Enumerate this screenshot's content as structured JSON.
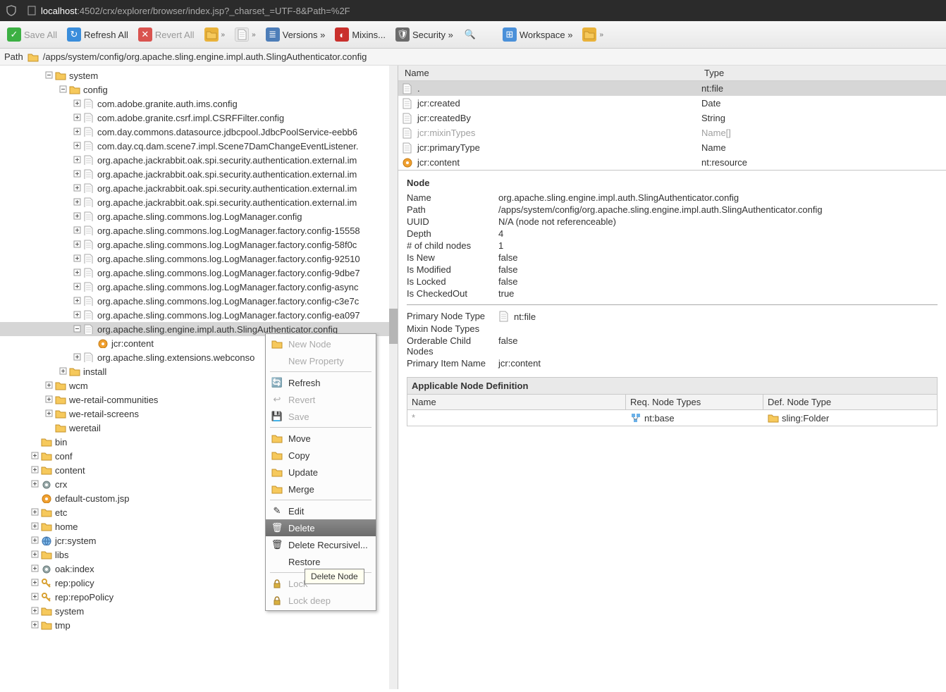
{
  "url_prefix": "localhost",
  "url_suffix": ":4502/crx/explorer/browser/index.jsp?_charset_=UTF-8&Path=%2F",
  "toolbar": {
    "save_all": "Save All",
    "refresh_all": "Refresh All",
    "revert_all": "Revert All",
    "versions": "Versions »",
    "mixins": "Mixins...",
    "security": "Security »",
    "workspace": "Workspace »"
  },
  "path_label": "Path",
  "path_value": "/apps/system/config/org.apache.sling.engine.impl.auth.SlingAuthenticator.config",
  "tree": {
    "system": "system",
    "config": "config",
    "children": [
      "com.adobe.granite.auth.ims.config",
      "com.adobe.granite.csrf.impl.CSRFFilter.config",
      "com.day.commons.datasource.jdbcpool.JdbcPoolService-eebb6",
      "com.day.cq.dam.scene7.impl.Scene7DamChangeEventListener.",
      "org.apache.jackrabbit.oak.spi.security.authentication.external.im",
      "org.apache.jackrabbit.oak.spi.security.authentication.external.im",
      "org.apache.jackrabbit.oak.spi.security.authentication.external.im",
      "org.apache.jackrabbit.oak.spi.security.authentication.external.im",
      "org.apache.sling.commons.log.LogManager.config",
      "org.apache.sling.commons.log.LogManager.factory.config-15558",
      "org.apache.sling.commons.log.LogManager.factory.config-58f0c",
      "org.apache.sling.commons.log.LogManager.factory.config-92510",
      "org.apache.sling.commons.log.LogManager.factory.config-9dbe7",
      "org.apache.sling.commons.log.LogManager.factory.config-async",
      "org.apache.sling.commons.log.LogManager.factory.config-c3e7c",
      "org.apache.sling.commons.log.LogManager.factory.config-ea097"
    ],
    "selected": "org.apache.sling.engine.impl.auth.SlingAuthenticator.config",
    "jcr_content": "jcr:content",
    "webcons": "org.apache.sling.extensions.webconso",
    "install": "install",
    "wcm": "wcm",
    "wrc": "we-retail-communities",
    "wrs": "we-retail-screens",
    "weretail": "weretail",
    "bin": "bin",
    "conf": "conf",
    "content": "content",
    "crx": "crx",
    "dcj": "default-custom.jsp",
    "etc": "etc",
    "home": "home",
    "jcrsys": "jcr:system",
    "libs": "libs",
    "oaki": "oak:index",
    "repp": "rep:policy",
    "reprp": "rep:repoPolicy",
    "sys2": "system",
    "tmp": "tmp"
  },
  "props": {
    "head_name": "Name",
    "head_type": "Type",
    "rows": [
      {
        "name": ".",
        "type": "nt:file",
        "ico": "file",
        "sel": true
      },
      {
        "name": "jcr:created",
        "type": "Date",
        "ico": "file"
      },
      {
        "name": "jcr:createdBy",
        "type": "String",
        "ico": "file"
      },
      {
        "name": "jcr:mixinTypes",
        "type": "Name[]",
        "ico": "file",
        "muted": true
      },
      {
        "name": "jcr:primaryType",
        "type": "Name",
        "ico": "file"
      },
      {
        "name": "jcr:content",
        "type": "nt:resource",
        "ico": "res"
      }
    ]
  },
  "node": {
    "title": "Node",
    "name_l": "Name",
    "name_v": "org.apache.sling.engine.impl.auth.SlingAuthenticator.config",
    "path_l": "Path",
    "path_v": "/apps/system/config/org.apache.sling.engine.impl.auth.SlingAuthenticator.config",
    "uuid_l": "UUID",
    "uuid_v": "N/A (node not referenceable)",
    "depth_l": "Depth",
    "depth_v": "4",
    "nchild_l": "# of child nodes",
    "nchild_v": "1",
    "isnew_l": "Is New",
    "isnew_v": "false",
    "ismod_l": "Is Modified",
    "ismod_v": "false",
    "islock_l": "Is Locked",
    "islock_v": "false",
    "isco_l": "Is CheckedOut",
    "isco_v": "true",
    "pnt_l": "Primary Node Type",
    "pnt_v": "nt:file",
    "mnt_l": "Mixin Node Types",
    "ocn_l": "Orderable Child Nodes",
    "ocn_v": "false",
    "pin_l": "Primary Item Name",
    "pin_v": "jcr:content"
  },
  "app": {
    "title": "Applicable Node Definition",
    "c1": "Name",
    "c2": "Req. Node Types",
    "c3": "Def. Node Type",
    "r1": "*",
    "r2": "nt:base",
    "r3": "sling:Folder"
  },
  "ctx": {
    "new_node": "New Node",
    "new_prop": "New Property",
    "refresh": "Refresh",
    "revert": "Revert",
    "save": "Save",
    "move": "Move",
    "copy": "Copy",
    "update": "Update",
    "merge": "Merge",
    "edit": "Edit",
    "delete": "Delete",
    "delete_rec": "Delete Recursivel...",
    "restore": "Restore",
    "lock": "Lock",
    "lock_deep": "Lock deep"
  },
  "tooltip": "Delete Node"
}
